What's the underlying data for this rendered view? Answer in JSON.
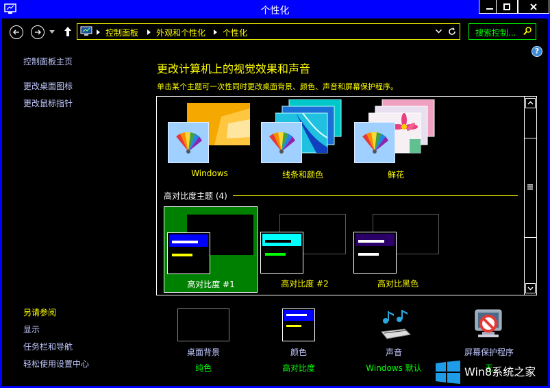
{
  "window": {
    "title": "个性化"
  },
  "address": {
    "crumbs": [
      "控制面板",
      "外观和个性化",
      "个性化"
    ],
    "search_placeholder": "搜索控制..."
  },
  "sidebar": {
    "links": [
      "控制面板主页",
      "更改桌面图标",
      "更改鼠标指针"
    ],
    "see_also_title": "另请参阅",
    "see_also_links": [
      "显示",
      "任务栏和导航",
      "轻松使用设置中心"
    ]
  },
  "main": {
    "heading": "更改计算机上的视觉效果和声音",
    "description": "单击某个主题可一次性同时更改桌面背景、颜色、声音和屏幕保护程序。",
    "themes": [
      "Windows",
      "线条和颜色",
      "鲜花"
    ],
    "high_contrast_group": "高对比度主题 (4)",
    "high_contrast_themes": [
      "高对比度 #1",
      "高对比度 #2",
      "高对比黑色"
    ]
  },
  "bottom": [
    {
      "label": "桌面背景",
      "value": "纯色",
      "icon": "desktop-background-icon"
    },
    {
      "label": "颜色",
      "value": "高对比度",
      "icon": "color-icon"
    },
    {
      "label": "声音",
      "value": "Windows 默认",
      "icon": "sound-icon"
    },
    {
      "label": "屏幕保护程序",
      "value": "无",
      "icon": "screensaver-icon"
    }
  ],
  "watermark": {
    "text": "Win8系统之家"
  },
  "colors": {
    "titlebar": "#0000ff",
    "heading": "#ffff00",
    "link": "#c0c8ff",
    "value": "#00ff00",
    "selected": "#008000",
    "hc1_head": "#0000ff",
    "hc2_head": "#00ffff",
    "hcblack_head": "#2a0068"
  }
}
